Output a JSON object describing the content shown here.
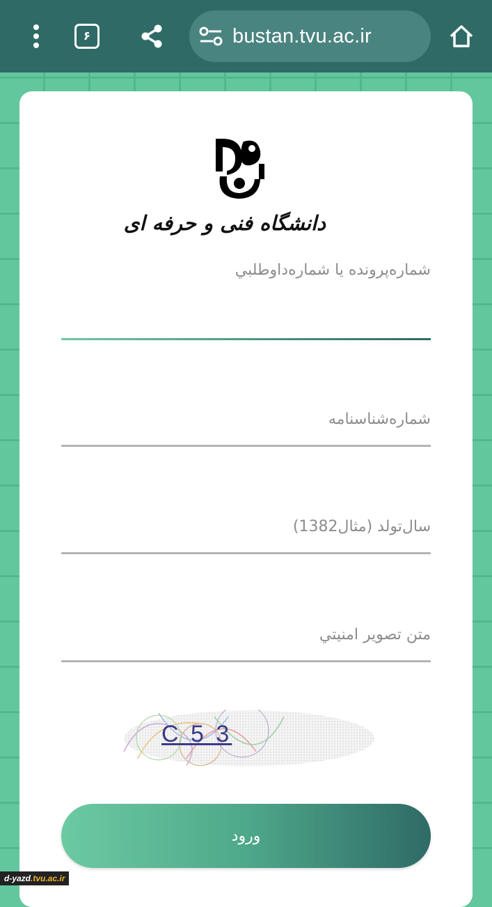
{
  "browser": {
    "url": "bustan.tvu.ac.ir",
    "tab_count": "۶",
    "icons": [
      "more-vert-icon",
      "tab-count-icon",
      "share-icon",
      "site-settings-icon",
      "home-icon"
    ]
  },
  "logo": {
    "university_name": "دانشگاه فنی و حرفه ای"
  },
  "form": {
    "fields": [
      {
        "label": "شماره‌پرونده یا شماره‌داوطلبي",
        "value": ""
      },
      {
        "label": "شماره‌شناسنامه",
        "value": ""
      },
      {
        "label": "سال‌تولد (مثال1382)",
        "value": ""
      },
      {
        "label": "متن تصوير امنيتي",
        "value": ""
      }
    ],
    "captcha_text": "C 5 3",
    "submit_label": "ورود"
  },
  "watermark": {
    "prefix": "d-yazd",
    "suffix": ".tvu.ac.ir"
  },
  "colors": {
    "toolbar": "#2f6a66",
    "background": "#63c79d",
    "accent_start": "#6ccaa2",
    "accent_end": "#2f6a66"
  }
}
